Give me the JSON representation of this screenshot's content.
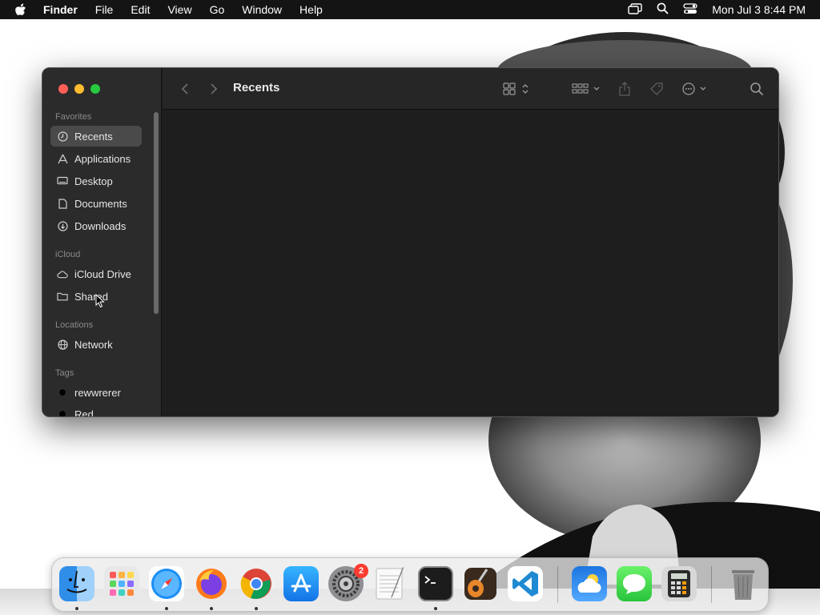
{
  "menubar": {
    "app_name": "Finder",
    "menus": [
      "File",
      "Edit",
      "View",
      "Go",
      "Window",
      "Help"
    ],
    "clock": "Mon Jul 3  8:44 PM",
    "status_icons": [
      "screen-mirroring-icon",
      "spotlight-search-icon",
      "control-center-icon"
    ]
  },
  "window": {
    "title": "Recents",
    "sidebar": {
      "sections": {
        "favorites": "Favorites",
        "icloud": "iCloud",
        "locations": "Locations",
        "tags": "Tags"
      },
      "favorites": [
        {
          "label": "Recents",
          "icon": "clock-icon",
          "selected": true
        },
        {
          "label": "Applications",
          "icon": "applications-icon"
        },
        {
          "label": "Desktop",
          "icon": "desktop-icon"
        },
        {
          "label": "Documents",
          "icon": "document-icon"
        },
        {
          "label": "Downloads",
          "icon": "downloads-icon"
        }
      ],
      "icloud": [
        {
          "label": "iCloud Drive",
          "icon": "cloud-icon"
        },
        {
          "label": "Shared",
          "icon": "shared-folder-icon"
        }
      ],
      "locations": [
        {
          "label": "Network",
          "icon": "network-globe-icon"
        }
      ],
      "tags": [
        {
          "label": "rewwrerer",
          "color": "#000000"
        },
        {
          "label": "Red",
          "color": "#000000"
        }
      ]
    },
    "toolbar_icons": [
      "back-chevron-icon",
      "forward-chevron-icon",
      "icon-view-icon",
      "group-by-icon",
      "share-icon",
      "tag-icon",
      "more-actions-icon",
      "search-icon"
    ]
  },
  "dock": {
    "apps": [
      {
        "name": "Finder",
        "running": true
      },
      {
        "name": "Launchpad",
        "running": false
      },
      {
        "name": "Safari",
        "running": true
      },
      {
        "name": "Firefox",
        "running": true
      },
      {
        "name": "Google Chrome",
        "running": true
      },
      {
        "name": "App Store",
        "running": false
      },
      {
        "name": "System Settings",
        "running": false,
        "badge": "2"
      },
      {
        "name": "TextEdit",
        "running": false
      },
      {
        "name": "Terminal",
        "running": true
      },
      {
        "name": "GarageBand",
        "running": false
      },
      {
        "name": "Visual Studio Code",
        "running": false
      },
      {
        "name": "Weather",
        "running": false
      },
      {
        "name": "Messages",
        "running": false
      },
      {
        "name": "Calculator",
        "running": false
      },
      {
        "name": "Trash",
        "running": false
      }
    ]
  }
}
